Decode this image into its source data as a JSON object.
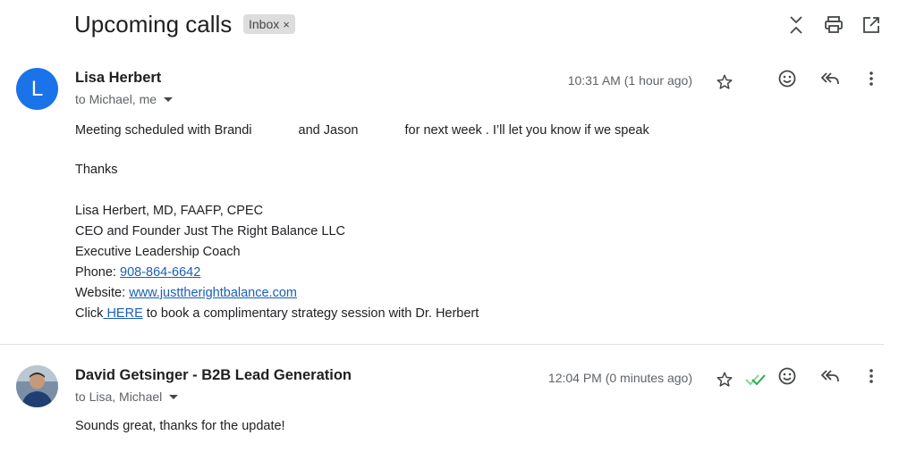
{
  "thread": {
    "subject": "Upcoming calls",
    "label_chip": "Inbox",
    "label_chip_close": "×"
  },
  "toolbar": {
    "icons": [
      "collapse-all-icon",
      "print-icon",
      "open-in-new-window-icon"
    ]
  },
  "messages": [
    {
      "avatar_letter": "L",
      "avatar_color": "#1a73e8",
      "sender": "Lisa Herbert",
      "to": "to Michael, me",
      "time": "10:31 AM (1 hour ago)",
      "body": {
        "line1_a": "Meeting scheduled with Brandi",
        "line1_b": "and Jason",
        "line1_c": "for next week . I’ll let you know if we speak",
        "thanks": "Thanks",
        "sig_name": "Lisa Herbert, MD, FAAFP, CPEC",
        "sig_title": "CEO and Founder Just The Right Balance LLC",
        "sig_role": "Executive Leadership Coach",
        "phone_label": "Phone:",
        "phone": "908-864-6642",
        "website_label": "Website:",
        "website": "www.justtherightbalance.com",
        "click_a": "Click",
        "click_link": " HERE",
        "click_b": " to book a complimentary strategy session with Dr. Herbert"
      }
    },
    {
      "sender": "David Getsinger - B2B Lead Generation",
      "to": "to Lisa, Michael",
      "time": "12:04 PM (0 minutes ago)",
      "body": {
        "line1": "Sounds great, thanks for the update!"
      }
    }
  ],
  "colors": {
    "link": "#1a5fb4",
    "chip_bg": "#dddddd",
    "check_green": "#34a853"
  }
}
